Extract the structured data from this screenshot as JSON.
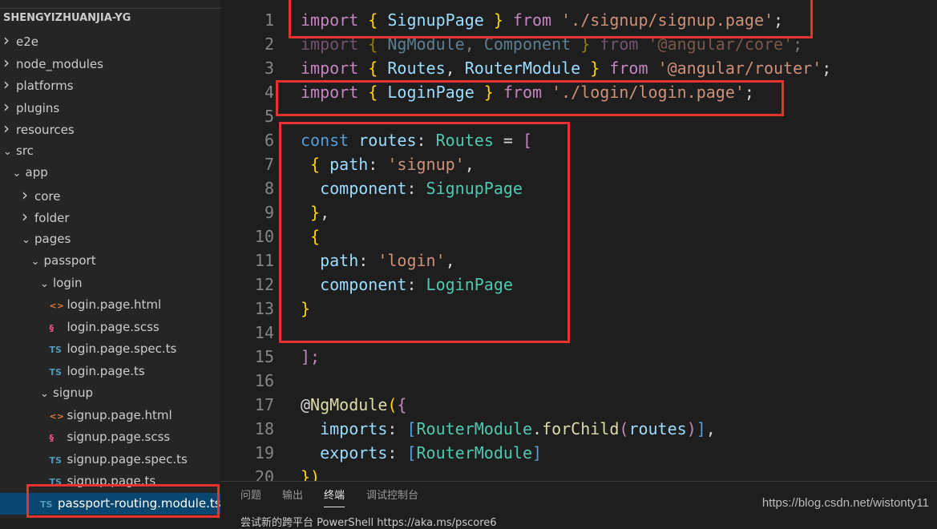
{
  "explorer": {
    "project": "SHENGYIZHUANJIA-YG",
    "items": [
      {
        "label": "e2e",
        "type": "folder",
        "depth": 0,
        "open": false
      },
      {
        "label": "node_modules",
        "type": "folder",
        "depth": 0,
        "open": false
      },
      {
        "label": "platforms",
        "type": "folder",
        "depth": 0,
        "open": false
      },
      {
        "label": "plugins",
        "type": "folder",
        "depth": 0,
        "open": false
      },
      {
        "label": "resources",
        "type": "folder",
        "depth": 0,
        "open": false
      },
      {
        "label": "src",
        "type": "folder",
        "depth": 0,
        "open": true
      },
      {
        "label": "app",
        "type": "folder",
        "depth": 1,
        "open": true
      },
      {
        "label": "core",
        "type": "folder",
        "depth": 2,
        "open": false
      },
      {
        "label": "folder",
        "type": "folder",
        "depth": 2,
        "open": false
      },
      {
        "label": "pages",
        "type": "folder",
        "depth": 2,
        "open": true
      },
      {
        "label": "passport",
        "type": "folder",
        "depth": 3,
        "open": true
      },
      {
        "label": "login",
        "type": "folder",
        "depth": 4,
        "open": true
      },
      {
        "label": "login.page.html",
        "type": "html",
        "depth": 5
      },
      {
        "label": "login.page.scss",
        "type": "scss",
        "depth": 5
      },
      {
        "label": "login.page.spec.ts",
        "type": "ts",
        "depth": 5
      },
      {
        "label": "login.page.ts",
        "type": "ts",
        "depth": 5
      },
      {
        "label": "signup",
        "type": "folder",
        "depth": 4,
        "open": true
      },
      {
        "label": "signup.page.html",
        "type": "html",
        "depth": 5
      },
      {
        "label": "signup.page.scss",
        "type": "scss",
        "depth": 5
      },
      {
        "label": "signup.page.spec.ts",
        "type": "ts",
        "depth": 5
      },
      {
        "label": "signup.page.ts",
        "type": "ts",
        "depth": 5
      },
      {
        "label": "passport-routing.module.ts",
        "type": "ts",
        "depth": 4,
        "selected": true
      }
    ]
  },
  "code": [
    [
      [
        "import",
        "kw"
      ],
      [
        " { ",
        "br"
      ],
      [
        "SignupPage",
        "id"
      ],
      [
        " } ",
        "br"
      ],
      [
        "from",
        "kw"
      ],
      [
        " ",
        "pu"
      ],
      [
        "'./signup/signup.page'",
        "str"
      ],
      [
        ";",
        "pu"
      ]
    ],
    [
      [
        "import",
        "kw dim"
      ],
      [
        " { ",
        "br dim"
      ],
      [
        "NgModule",
        "id dim"
      ],
      [
        ", ",
        "pu dim"
      ],
      [
        "Component",
        "id dim"
      ],
      [
        " } ",
        "br dim"
      ],
      [
        "from",
        "kw dim"
      ],
      [
        " ",
        "pu"
      ],
      [
        "'@angular/core'",
        "str dim"
      ],
      [
        ";",
        "pu dim"
      ]
    ],
    [
      [
        "import",
        "kw"
      ],
      [
        " { ",
        "br"
      ],
      [
        "Routes",
        "id"
      ],
      [
        ", ",
        "pu"
      ],
      [
        "RouterModule",
        "id"
      ],
      [
        " } ",
        "br"
      ],
      [
        "from",
        "kw"
      ],
      [
        " ",
        "pu"
      ],
      [
        "'@angular/router'",
        "str"
      ],
      [
        ";",
        "pu"
      ]
    ],
    [
      [
        "import",
        "kw"
      ],
      [
        " { ",
        "br"
      ],
      [
        "LoginPage",
        "id"
      ],
      [
        " } ",
        "br"
      ],
      [
        "from",
        "kw"
      ],
      [
        " ",
        "pu"
      ],
      [
        "'./login/login.page'",
        "str"
      ],
      [
        ";",
        "pu"
      ]
    ],
    [],
    [
      [
        "const",
        "st"
      ],
      [
        " ",
        "pu"
      ],
      [
        "routes",
        "id"
      ],
      [
        ": ",
        "pu"
      ],
      [
        "Routes",
        "ty"
      ],
      [
        " = ",
        "pu"
      ],
      [
        "[",
        "kw"
      ]
    ],
    [
      [
        " { ",
        "br"
      ],
      [
        "path",
        "id"
      ],
      [
        ": ",
        "pu"
      ],
      [
        "'signup'",
        "str"
      ],
      [
        ",",
        "pu"
      ]
    ],
    [
      [
        "  component",
        "id"
      ],
      [
        ": ",
        "pu"
      ],
      [
        "SignupPage",
        "ty"
      ]
    ],
    [
      [
        " }",
        "br"
      ],
      [
        ",",
        "pu"
      ]
    ],
    [
      [
        " {",
        "br"
      ]
    ],
    [
      [
        "  path",
        "id"
      ],
      [
        ": ",
        "pu"
      ],
      [
        "'login'",
        "str"
      ],
      [
        ",",
        "pu"
      ]
    ],
    [
      [
        "  component",
        "id"
      ],
      [
        ": ",
        "pu"
      ],
      [
        "LoginPage",
        "ty"
      ]
    ],
    [
      [
        "}",
        "br"
      ]
    ],
    [],
    [
      [
        "];",
        "kw"
      ]
    ],
    [],
    [
      [
        "@",
        "pu"
      ],
      [
        "NgModule",
        "fn"
      ],
      [
        "(",
        "br"
      ],
      [
        "{",
        "kw"
      ]
    ],
    [
      [
        "  imports",
        "id"
      ],
      [
        ": ",
        "pu"
      ],
      [
        "[",
        "st"
      ],
      [
        "RouterModule",
        "ty"
      ],
      [
        ".",
        "pu"
      ],
      [
        "forChild",
        "fn"
      ],
      [
        "(",
        "kw"
      ],
      [
        "routes",
        "id"
      ],
      [
        ")",
        "kw"
      ],
      [
        "]",
        "st"
      ],
      [
        ",",
        "pu"
      ]
    ],
    [
      [
        "  exports",
        "id"
      ],
      [
        ": ",
        "pu"
      ],
      [
        "[",
        "st"
      ],
      [
        "RouterModule",
        "ty"
      ],
      [
        "]",
        "st"
      ]
    ],
    [
      [
        "})",
        "br"
      ]
    ]
  ],
  "panel": {
    "tabs": [
      "问题",
      "输出",
      "终端",
      "调试控制台"
    ],
    "active": 2,
    "terminal_text": "尝试新的跨平台 PowerShell https://aka.ms/pscore6"
  },
  "watermark": "https://blog.csdn.net/wistonty11"
}
